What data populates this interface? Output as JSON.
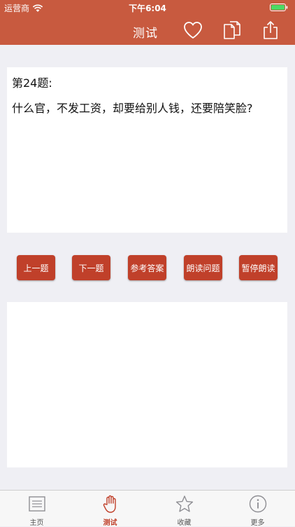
{
  "status_bar": {
    "carrier": "运营商",
    "time": "下午6:04"
  },
  "nav": {
    "title": "测试",
    "icons": [
      "heart-icon",
      "copy-icon",
      "share-icon"
    ]
  },
  "question": {
    "number_label": "第24题:",
    "text": "什么官，不发工资，却要给别人钱，还要陪笑脸?"
  },
  "buttons": [
    {
      "label": "上一题"
    },
    {
      "label": "下一题"
    },
    {
      "label": "参考答案"
    },
    {
      "label": "朗读问题"
    },
    {
      "label": "暂停朗读"
    }
  ],
  "tabs": [
    {
      "label": "主页",
      "icon": "document-icon",
      "active": false
    },
    {
      "label": "测试",
      "icon": "hand-icon",
      "active": true
    },
    {
      "label": "收藏",
      "icon": "star-icon",
      "active": false
    },
    {
      "label": "更多",
      "icon": "info-icon",
      "active": false
    }
  ],
  "colors": {
    "header": "#c85a3f",
    "button": "#c0402a",
    "background": "#efeff4",
    "active_tab": "#c0402a"
  }
}
